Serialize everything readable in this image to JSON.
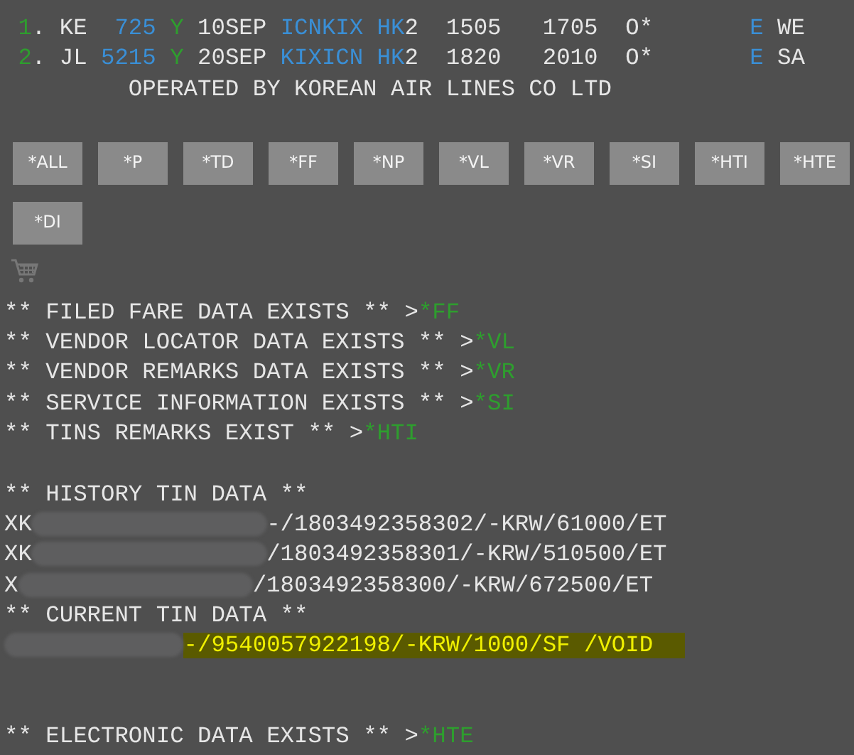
{
  "flight_segments": [
    {
      "parts": [
        {
          "text": "1",
          "color": "#2e9e2e"
        },
        {
          "text": ". KE  ",
          "color": "#e6e6e6"
        },
        {
          "text": "725",
          "color": "#3a8fd6"
        },
        {
          "text": " Y",
          "color": "#2e9e2e"
        },
        {
          "text": " 10SEP ",
          "color": "#e6e6e6"
        },
        {
          "text": "ICNKIX HK",
          "color": "#3a8fd6"
        },
        {
          "text": "2  1505   1705  O*       ",
          "color": "#e6e6e6"
        },
        {
          "text": "E",
          "color": "#3a8fd6"
        },
        {
          "text": " WE",
          "color": "#e6e6e6"
        }
      ]
    },
    {
      "parts": [
        {
          "text": "2",
          "color": "#2e9e2e"
        },
        {
          "text": ". JL ",
          "color": "#e6e6e6"
        },
        {
          "text": "5215",
          "color": "#3a8fd6"
        },
        {
          "text": " Y",
          "color": "#2e9e2e"
        },
        {
          "text": " 20SEP ",
          "color": "#e6e6e6"
        },
        {
          "text": "KIXICN HK",
          "color": "#3a8fd6"
        },
        {
          "text": "2  1820   2010  O*       ",
          "color": "#e6e6e6"
        },
        {
          "text": "E",
          "color": "#3a8fd6"
        },
        {
          "text": " SA",
          "color": "#e6e6e6"
        }
      ]
    }
  ],
  "operated_by": "OPERATED BY KOREAN AIR LINES CO LTD",
  "buttons": [
    "*ALL",
    "*P",
    "*TD",
    "*FF",
    "*NP",
    "*VL",
    "*VR",
    "*SI",
    "*HTI",
    "*HTE",
    "*DI"
  ],
  "notices": [
    {
      "text": "** FILED FARE DATA EXISTS ** >",
      "link": "*FF"
    },
    {
      "text": "** VENDOR LOCATOR DATA EXISTS ** >",
      "link": "*VL"
    },
    {
      "text": "** VENDOR REMARKS DATA EXISTS ** >",
      "link": "*VR"
    },
    {
      "text": "** SERVICE INFORMATION EXISTS ** >",
      "link": "*SI"
    },
    {
      "text": "** TINS REMARKS EXIST ** >",
      "link": "*HTI"
    }
  ],
  "history_tin": {
    "heading": "** HISTORY TIN DATA **",
    "rows": [
      {
        "prefix": "XK",
        "redacted": true,
        "text": "-/1803492358302/-KRW/61000/ET",
        "highlighted": false
      },
      {
        "prefix": "XK",
        "redacted": true,
        "text": "/1803492358301/-KRW/510500/ET",
        "highlighted": false
      },
      {
        "prefix": "X",
        "redacted": true,
        "text": "/1803492358300/-KRW/672500/ET",
        "highlighted": false
      }
    ]
  },
  "current_tin": {
    "heading": "** CURRENT TIN DATA **",
    "rows": [
      {
        "redacted": true,
        "text": "-/9540057922198/-KRW/1000/SF /VOID",
        "highlighted": true
      }
    ]
  },
  "electronic_notice": {
    "text": "** ELECTRONIC DATA EXISTS ** >",
    "link": "*HTE"
  }
}
